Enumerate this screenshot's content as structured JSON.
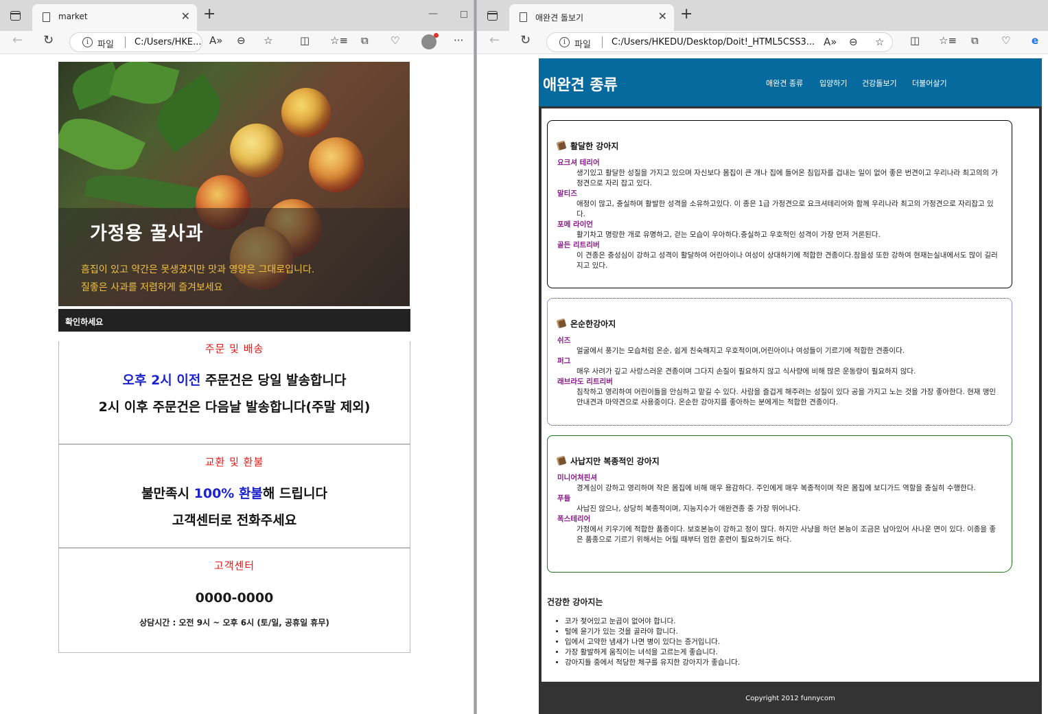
{
  "left_window": {
    "tab_title": "market",
    "address_scheme": "파일",
    "address_url": "C:/Users/HKE...",
    "page": {
      "hero_title": "가정용 꿀사과",
      "hero_sub_line1": "흠집이 있고 약간은 못생겼지만 맛과 영양은 그대로입니다.",
      "hero_sub_line2": "질좋은 사과를 저렴하게 즐겨보세요",
      "check_bar": "확인하세요",
      "section1": {
        "heading": "주문 및 배송",
        "line1_highlight": "오후 2시 이전",
        "line1_rest": " 주문건은 당일 발송합니다",
        "line2": "2시 이후 주문건은 다음날 발송합니다(주말 제외)"
      },
      "section2": {
        "heading": "교환 및 환불",
        "line1_pre": "불만족시 ",
        "line1_highlight": "100% 환불",
        "line1_post": "해 드립니다",
        "line2": "고객센터로 전화주세요"
      },
      "section3": {
        "heading": "고객센터",
        "phone": "0000-0000",
        "hours": "상담시간 : 오전 9시 ~ 오후 6시 (토/일, 공휴일 휴무)"
      }
    }
  },
  "right_window": {
    "tab_title": "애완견 돌보기",
    "address_scheme": "파일",
    "address_url": "C:/Users/HKEDU/Desktop/Doit!_HTML5CSS3...",
    "page": {
      "site_title": "애완견 종류",
      "nav": [
        "애완견 종류",
        "입양하기",
        "건강돌보기",
        "더불어살기"
      ],
      "boxes": [
        {
          "title": "활달한 강아지",
          "items": [
            {
              "name": "요크셔 테리어",
              "desc": "생기있고 활달한 성질을 가지고 있으며 자신보다 몸집이 큰 개나 집에 들어온 침입자를 겁내는 일이 없어 좋은 번견이고 우리나라 최고의의 가정견으로 자리 잡고 있다."
            },
            {
              "name": "말티즈",
              "desc": "애정이 많고, 충실하며 활발한 성격을 소유하고있다. 이 종은 1급 가정견으로 요크셔테리어와 함께 우리나라 최고의 가정견으로 자리잡고 있다."
            },
            {
              "name": "포메 라이언",
              "desc": "활기차고 명랑한 개로 유명하고, 걷는 모습이 우아하다.충실하고 우호적인 성격이 가장 먼저 거론된다."
            },
            {
              "name": "골든 리트리버",
              "desc": "이 견종은 충성심이 강하고 성격이 활달하여 어린아이나 여성이 상대하기에 적합한 견종이다.참을성 또한 강하여 현재는실내에서도 많이 길러지고 있다."
            }
          ]
        },
        {
          "title": "온순한강아지",
          "items": [
            {
              "name": "쉬즈",
              "desc": "얼굴에서 풍기는 모습처럼 온순, 쉽게 친숙해지고 우호적이며,어린아이나 여성들이 기르기에 적합한 견종이다."
            },
            {
              "name": "퍼그",
              "desc": "매우 사려가 깊고 사랑스러운 견종이며 그다지 손질이 필요하지 않고 식사량에 비해 많은 운동량이 필요하지 않다."
            },
            {
              "name": "래브라도 리트리버",
              "desc": "침착하고 영리하여 어린이들을 안심하고 맡길 수 있다. 사람을 즐겁게 해주려는 성질이 있다 공을 가지고 노는 것을 가장 좋아한다. 현재 맹인 안내견과 마약견으로 사용중이다. 온순한 강아지를 좋아하는 분에게는 적합한 견종이다."
            }
          ]
        },
        {
          "title": "사납지만 복종적인 강아지",
          "items": [
            {
              "name": "미니어쳐핀셔",
              "desc": "경계심이 강하고 영리하며 작은 몸집에 비해 매우 용감하다. 주인에게 매우 복종적이며 작은 몸집에 보디가드 역할을 충실히 수행한다."
            },
            {
              "name": "푸들",
              "desc": "사납진 않으나, 상당히 복종적이며, 지능지수가 애완견종 중 가장 뛰어나다."
            },
            {
              "name": "폭스테리어",
              "desc": "가정에서 키우기에 적합한 품종이다. 보호본능이 강하고 정이 많다. 하지만 사냥을 하던 본능이 조금은 남아있어 사나운 면이 있다. 이종을 좋은 품종으로 기르기 위해서는 어릴 때부터 엄한 훈련이 필요하기도 하다."
            }
          ]
        }
      ],
      "health_title": "건강한 강아지는",
      "health_list": [
        "코가 젖어있고 눈곱이 없어야 합니다.",
        "털에 윤기가 있는 것을 골라야 합니다.",
        "입에서 고약한 냄새가 나면 병이 있다는 증거입니다.",
        "가장 활발하게 움직이는 녀석을 고르는게 좋습니다.",
        "강아지들 중에서 적당한 체구를 유지한 강아지가 좋습니다."
      ],
      "footer": "Copyright 2012 funnycom"
    }
  },
  "colors": {
    "dog_header": "#076a9e",
    "dog_name": "#8a1a8a",
    "red_heading": "#e01b1b",
    "blue_highlight": "#1a22cc",
    "hero_sub": "#f0c040"
  },
  "icons": [
    "window-tabs-icon",
    "page-icon",
    "close-icon",
    "new-tab-icon",
    "back-icon",
    "refresh-icon",
    "info-icon",
    "read-aloud-icon",
    "zoom-out-icon",
    "favorite-star-icon",
    "split-screen-icon",
    "favorites-list-icon",
    "collections-icon",
    "health-heart-icon",
    "profile-avatar",
    "more-icon",
    "book-icon"
  ]
}
